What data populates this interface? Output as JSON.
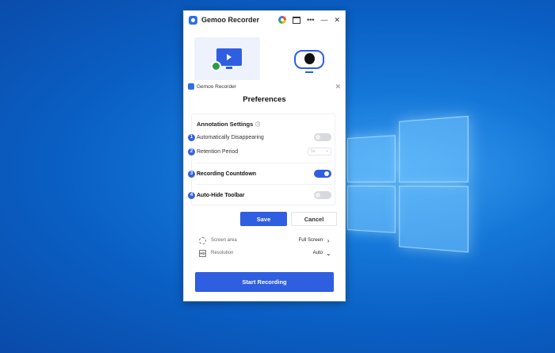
{
  "window": {
    "app_title": "Gemoo Recorder",
    "icons": [
      "gemoo-logo-icon",
      "color-circle-icon",
      "window-icon",
      "more-icon",
      "minimize-icon",
      "close-icon"
    ],
    "more_glyph": "•••",
    "minimize_glyph": "—",
    "close_glyph": "✕"
  },
  "modes": {
    "icons": [
      "screen-recording-icon",
      "webcam-recording-icon"
    ]
  },
  "dialog": {
    "app_title": "Gemoo Recorder",
    "close_glyph": "✕",
    "title": "Preferences",
    "section_title": "Annotation Settings",
    "info_glyph": "ⓘ",
    "rows": [
      {
        "badge": "1",
        "label": "Automatically Disappearing",
        "toggle_on": false
      },
      {
        "badge": "2",
        "label": "Retention Period",
        "select_value": "5s"
      },
      {
        "badge": "3",
        "label": "Recording Countdown",
        "toggle_on": true
      },
      {
        "badge": "4",
        "label": "Auto-Hide Toolbar",
        "toggle_on": false
      }
    ],
    "save_label": "Save",
    "cancel_label": "Cancel"
  },
  "options": [
    {
      "icon": "screen-area-icon",
      "label": "Screen area",
      "value": "Full Screen",
      "chevron": "›"
    },
    {
      "icon": "resolution-icon",
      "icon_text": "HD",
      "label": "Resolution",
      "value": "Auto",
      "chevron": "⌄"
    }
  ],
  "start_label": "Start Recording",
  "colors": {
    "accent": "#2f5ee0",
    "desktop": "#0a5fc4"
  }
}
